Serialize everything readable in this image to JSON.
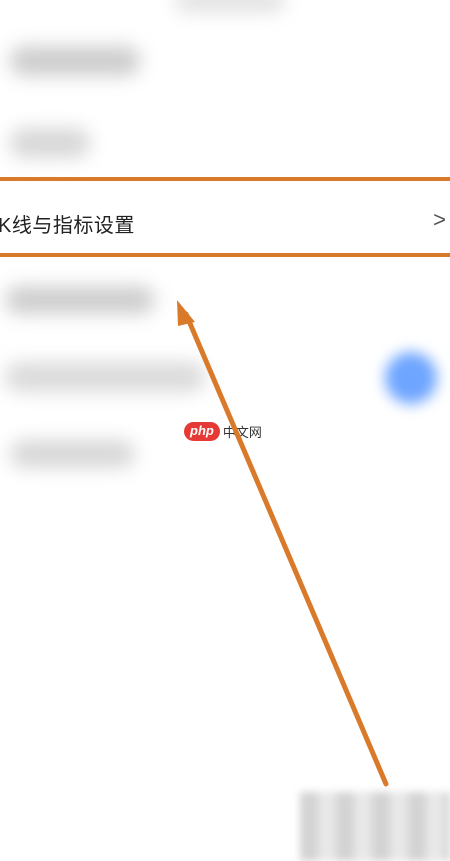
{
  "menu": {
    "highlighted_item": {
      "label": "K线与指标设置",
      "chevron": ">"
    }
  },
  "watermark": {
    "badge": "php",
    "text": "中文网"
  },
  "colors": {
    "highlight": "#d97a2b",
    "arrow": "#d97a2b",
    "watermark_badge": "#e53935",
    "accent_dot": "#6ea5ff"
  },
  "icons": {
    "row_chevron": "chevron-right-icon"
  }
}
